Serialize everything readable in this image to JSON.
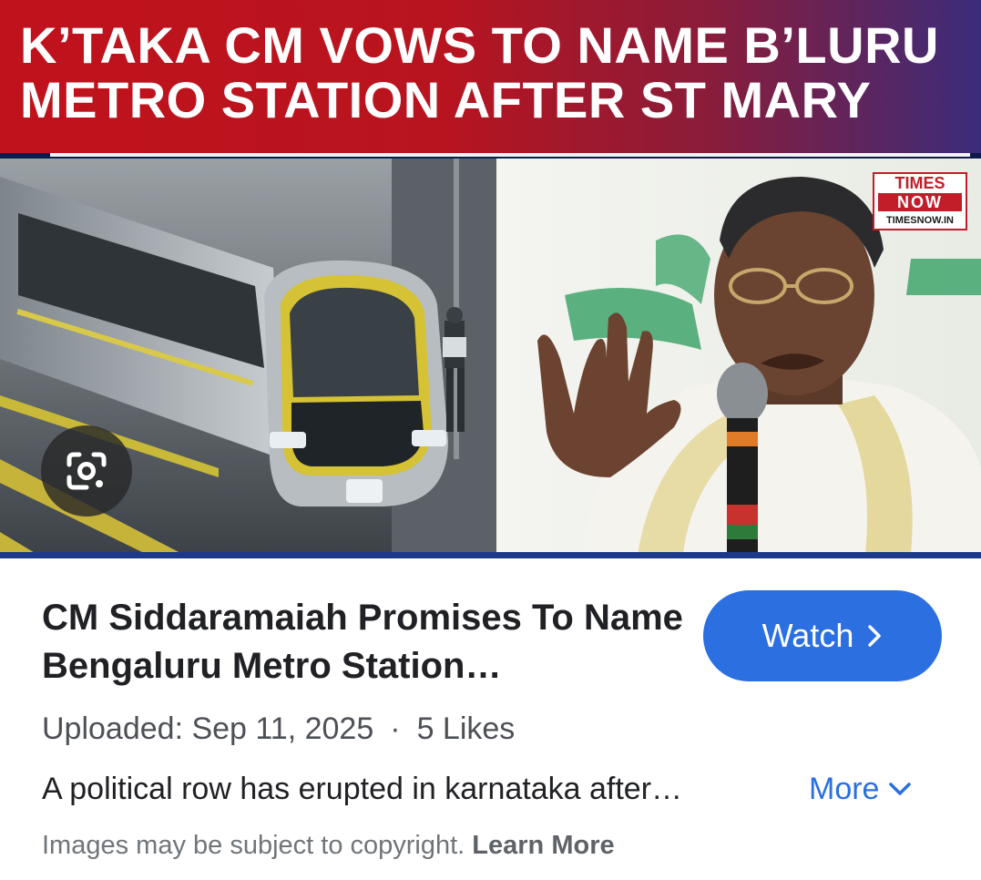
{
  "thumbnail": {
    "headline": "K’TAKA CM VOWS TO NAME B’LURU\nMETRO STATION AFTER ST MARY",
    "logo": {
      "line1": "TIMES",
      "line2": "NOW",
      "line3": "TIMESNOW.IN"
    },
    "lens_icon": "google-lens-camera-icon"
  },
  "result": {
    "title": "CM Siddaramaiah Promises To Name Bengaluru Metro Station…",
    "watch_label": "Watch",
    "watch_icon": "chevron-right-icon",
    "uploaded": "Uploaded: Sep 11, 2025",
    "separator": "·",
    "likes": "5 Likes",
    "description": "A political row has erupted in karnataka after…",
    "more_label": "More",
    "more_icon": "chevron-down-icon",
    "copyright_text": "Images may be subject to copyright.",
    "learn_more": "Learn More"
  },
  "colors": {
    "accent": "#2b6fe0",
    "headline_red": "#c0121c",
    "headline_blue": "#3b2c7a",
    "title_text": "#202124",
    "muted_text": "#70757a"
  }
}
